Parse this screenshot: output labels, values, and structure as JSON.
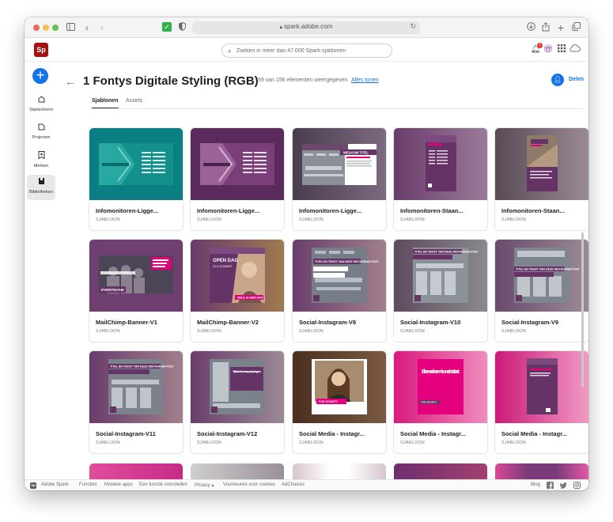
{
  "browser": {
    "url": "spark.adobe.com",
    "sidebar_toggle_icon": "sidebar-icon",
    "back_icon": "chevron-left-icon",
    "forward_icon": "chevron-right-icon",
    "extension_icon": "checkmark-extension-icon",
    "shield_icon": "shield-icon",
    "reload_icon": "reload-icon",
    "download_icon": "download-icon",
    "share_icon": "share-icon",
    "new_tab_icon": "plus-icon",
    "tabs_icon": "tabs-icon"
  },
  "app": {
    "logo": "Sp",
    "search_placeholder": "Zoeken in meer dan 47.000 Spark-sjablonen",
    "notification_count": "1"
  },
  "sidebar": {
    "create_label": "+",
    "items": [
      {
        "label": "Startscherm",
        "icon": "home-icon",
        "active": false
      },
      {
        "label": "Projecten",
        "icon": "projects-icon",
        "active": false
      },
      {
        "label": "Merken",
        "icon": "brand-icon",
        "active": false
      },
      {
        "label": "Bibliotheken",
        "icon": "library-icon",
        "active": true
      }
    ]
  },
  "header": {
    "title": "1 Fontys Digitale Styling (RGB)",
    "count_text": "59 van 156 elementen weergegeven",
    "show_all": "Alles tonen",
    "share_label": "Delen"
  },
  "tabs": [
    {
      "label": "Sjablonen",
      "active": true
    },
    {
      "label": "Assets",
      "active": false
    }
  ],
  "cards": [
    {
      "title": "Infomonitoren-Ligge...",
      "type": "SJABLOON"
    },
    {
      "title": "Infomonitoren-Ligge...",
      "type": "SJABLOON"
    },
    {
      "title": "Infomonitoren-Ligge...",
      "type": "SJABLOON"
    },
    {
      "title": "Infomonitoren-Staan...",
      "type": "SJABLOON"
    },
    {
      "title": "Infomonitoren-Staan...",
      "type": "SJABLOON"
    },
    {
      "title": "MailChimp-Banner-V1",
      "type": "SJABLOON"
    },
    {
      "title": "MailChimp-Banner-V2",
      "type": "SJABLOON"
    },
    {
      "title": "Social-Instagram-V8",
      "type": "SJABLOON"
    },
    {
      "title": "Social-Instagram-V10",
      "type": "SJABLOON"
    },
    {
      "title": "Social-Instagram-V9",
      "type": "SJABLOON"
    },
    {
      "title": "Social-Instagram-V11",
      "type": "SJABLOON"
    },
    {
      "title": "Social-Instagram-V12",
      "type": "SJABLOON"
    },
    {
      "title": "Social Media - Instagr...",
      "type": "SJABLOON"
    },
    {
      "title": "Social Media - Instagr...",
      "type": "SJABLOON"
    },
    {
      "title": "Social Media - Instagr...",
      "type": "SJABLOON"
    }
  ],
  "thumb_text": {
    "welcome": "WELKOM TITEL",
    "open_dag": "OPEN DAG",
    "open_dag_date": "23 & 24 MAART",
    "meld": "MELD JE HIER AAN",
    "event": "EVENTNAAM",
    "titel_ig": "TITEL EN TEKST VAN DEZE INSTAGRAM POST",
    "titel_link": "Titel, tekst en link van deze post op Instagram",
    "for_society": "FOR SOCIETY",
    "week": "Elke week een nieuwe teststraat"
  },
  "footer": {
    "brand": "Adobe Spark",
    "links": [
      "Functies",
      "Mobiele apps",
      "Een functie voorstellen",
      "Privacy ▴",
      "Voorkeuren voor cookies",
      "AdChoices"
    ],
    "blog": "Blog",
    "social_icons": [
      "facebook-icon",
      "twitter-icon",
      "instagram-icon"
    ]
  },
  "colors": {
    "accent": "#1473e6",
    "brand_red": "#a40f0f",
    "fontys_purple": "#663366",
    "fontys_magenta": "#e4007c",
    "teal": "#14908c"
  }
}
